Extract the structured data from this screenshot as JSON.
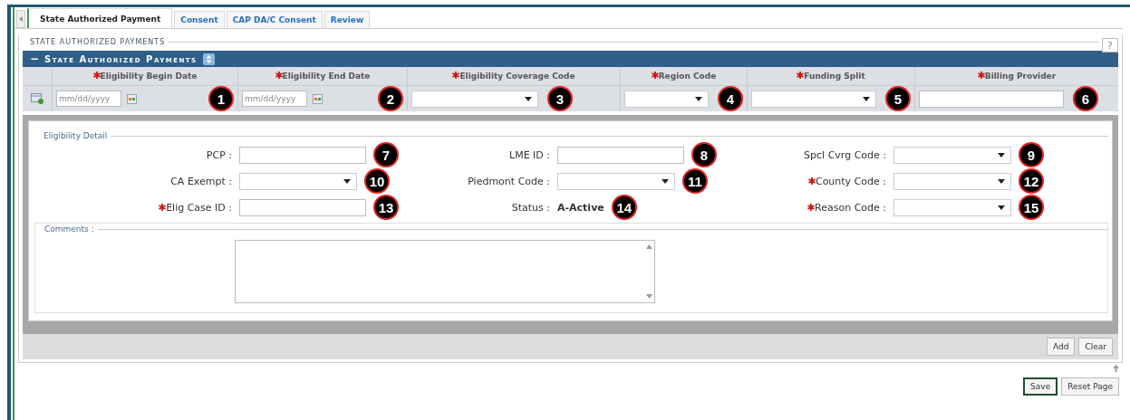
{
  "tabs": [
    {
      "label": "State Authorized Payment",
      "selected": true
    },
    {
      "label": "Consent",
      "selected": false
    },
    {
      "label": "CAP DA/C Consent",
      "selected": false
    },
    {
      "label": "Review",
      "selected": false
    }
  ],
  "section_title": "STATE AUTHORIZED PAYMENTS",
  "help": "?",
  "panel": {
    "title": "State Authorized Payments",
    "collapse": "−",
    "columns": [
      {
        "label": "Eligibility Begin Date",
        "required": true,
        "kind": "date",
        "placeholder": "mm/dd/yyyy",
        "callout": "1"
      },
      {
        "label": "Eligibility End Date",
        "required": true,
        "kind": "date",
        "placeholder": "mm/dd/yyyy",
        "callout": "2"
      },
      {
        "label": "Eligibility Coverage Code",
        "required": true,
        "kind": "select",
        "callout": "3"
      },
      {
        "label": "Region Code",
        "required": true,
        "kind": "select",
        "callout": "4"
      },
      {
        "label": "Funding Split",
        "required": true,
        "kind": "select",
        "callout": "5"
      },
      {
        "label": "Billing Provider",
        "required": true,
        "kind": "text",
        "callout": "6"
      }
    ]
  },
  "detail": {
    "title": "Eligibility Detail",
    "fields": [
      {
        "label": "PCP :",
        "required": false,
        "kind": "text",
        "callout": "7"
      },
      {
        "label": "LME ID :",
        "required": false,
        "kind": "text",
        "callout": "8"
      },
      {
        "label": "Spcl Cvrg Code :",
        "required": false,
        "kind": "select",
        "callout": "9"
      },
      {
        "label": "CA Exempt :",
        "required": false,
        "kind": "select",
        "callout": "10"
      },
      {
        "label": "Piedmont Code :",
        "required": false,
        "kind": "select",
        "callout": "11"
      },
      {
        "label": "County Code :",
        "required": true,
        "kind": "select",
        "callout": "12"
      },
      {
        "label": "Elig Case ID :",
        "required": true,
        "kind": "text",
        "callout": "13"
      },
      {
        "label": "Status :",
        "required": false,
        "kind": "value",
        "value": "A-Active",
        "callout": "14"
      },
      {
        "label": "Reason Code :",
        "required": true,
        "kind": "select",
        "callout": "15"
      }
    ],
    "comments_label": "Comments :"
  },
  "row_buttons": [
    "Add",
    "Clear"
  ],
  "page_buttons": [
    "Save",
    "Reset Page"
  ]
}
